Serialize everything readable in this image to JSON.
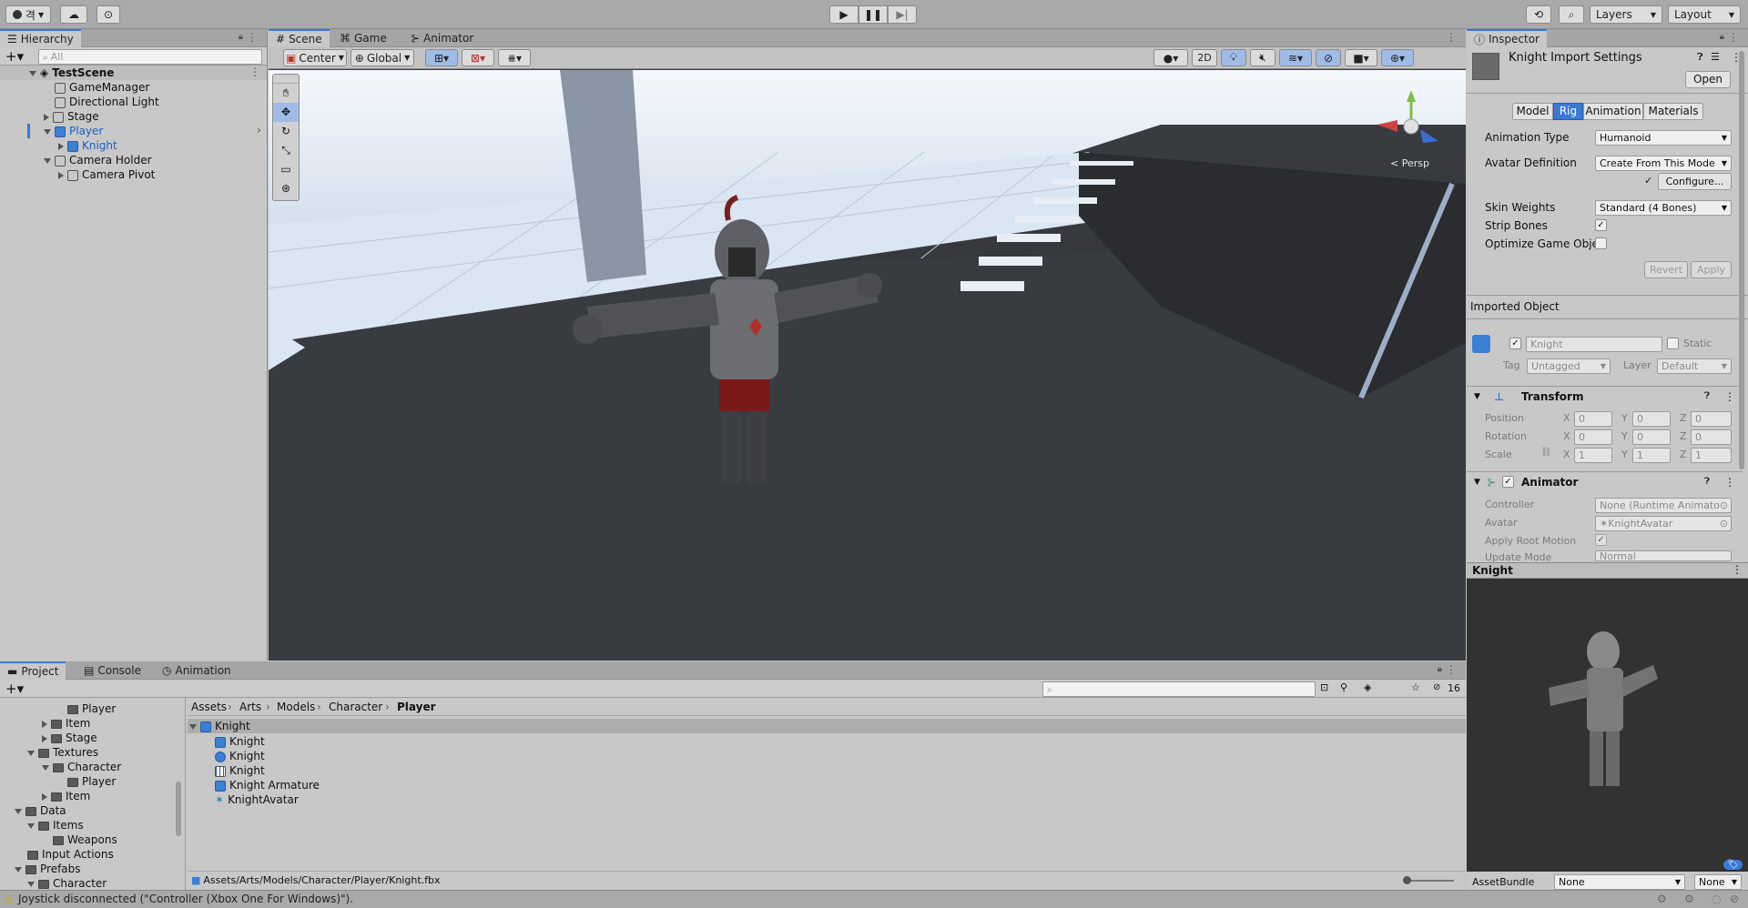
{
  "toolbar": {
    "account_label": "격",
    "layers_label": "Layers",
    "layout_label": "Layout"
  },
  "hierarchy": {
    "tab_label": "Hierarchy",
    "search_placeholder": "All",
    "scene_name": "TestScene",
    "items": [
      {
        "label": "GameManager"
      },
      {
        "label": "Directional Light"
      },
      {
        "label": "Stage"
      },
      {
        "label": "Player"
      },
      {
        "label": "Knight"
      },
      {
        "label": "Camera Holder"
      },
      {
        "label": "Camera Pivot"
      }
    ]
  },
  "scene": {
    "tabs": [
      {
        "label": "Scene"
      },
      {
        "label": "Game"
      },
      {
        "label": "Animator"
      }
    ],
    "pivot_label": "Center",
    "space_label": "Global",
    "twod_label": "2D",
    "persp_label": "< Persp"
  },
  "inspector": {
    "tab_label": "Inspector",
    "title": "Knight Import Settings",
    "open_label": "Open",
    "tabs": [
      {
        "label": "Model"
      },
      {
        "label": "Rig"
      },
      {
        "label": "Animation"
      },
      {
        "label": "Materials"
      }
    ],
    "animation_type_label": "Animation Type",
    "animation_type_value": "Humanoid",
    "avatar_definition_label": "Avatar Definition",
    "avatar_definition_value": "Create From This Mode",
    "configure_label": "Configure...",
    "skin_weights_label": "Skin Weights",
    "skin_weights_value": "Standard (4 Bones)",
    "strip_bones_label": "Strip Bones",
    "optimize_label": "Optimize Game Objec",
    "revert_label": "Revert",
    "apply_label": "Apply",
    "imported_object_label": "Imported Object",
    "object_name": "Knight",
    "static_label": "Static",
    "tag_label": "Tag",
    "tag_value": "Untagged",
    "layer_label": "Layer",
    "layer_value": "Default",
    "transform_label": "Transform",
    "position_label": "Position",
    "rotation_label": "Rotation",
    "scale_label": "Scale",
    "x": "X",
    "y": "Y",
    "z": "Z",
    "pos": [
      "0",
      "0",
      "0"
    ],
    "rot": [
      "0",
      "0",
      "0"
    ],
    "scl": [
      "1",
      "1",
      "1"
    ],
    "animator_label": "Animator",
    "controller_label": "Controller",
    "controller_value": "None (Runtime Animato",
    "avatar_label": "Avatar",
    "avatar_value": "KnightAvatar",
    "apply_root_motion_label": "Apply Root Motion",
    "update_mode_label": "Update Mode",
    "update_mode_value": "Normal",
    "preview_title": "Knight",
    "assetbundle_label": "AssetBundle",
    "assetbundle_value": "None",
    "assetbundle_variant": "None"
  },
  "project": {
    "tabs": [
      {
        "label": "Project"
      },
      {
        "label": "Console"
      },
      {
        "label": "Animation"
      }
    ],
    "count_label": "16",
    "folders": [
      {
        "label": "Player"
      },
      {
        "label": "Item"
      },
      {
        "label": "Stage"
      },
      {
        "label": "Textures"
      },
      {
        "label": "Character"
      },
      {
        "label": "Player"
      },
      {
        "label": "Item"
      },
      {
        "label": "Data"
      },
      {
        "label": "Items"
      },
      {
        "label": "Weapons"
      },
      {
        "label": "Input Actions"
      },
      {
        "label": "Prefabs"
      },
      {
        "label": "Character"
      }
    ],
    "breadcrumb": [
      "Assets",
      "Arts",
      "Models",
      "Character",
      "Player"
    ],
    "assets": [
      {
        "label": "Knight"
      },
      {
        "label": "Knight"
      },
      {
        "label": "Knight"
      },
      {
        "label": "Knight"
      },
      {
        "label": "Knight Armature"
      },
      {
        "label": "KnightAvatar"
      }
    ],
    "path": "Assets/Arts/Models/Character/Player/Knight.fbx"
  },
  "status": {
    "message": "Joystick disconnected (\"Controller (Xbox One For Windows)\")."
  },
  "colors": {
    "accent": "#3a79d6",
    "panel": "#c8c8c8",
    "toolbar": "#a9a9a9"
  }
}
